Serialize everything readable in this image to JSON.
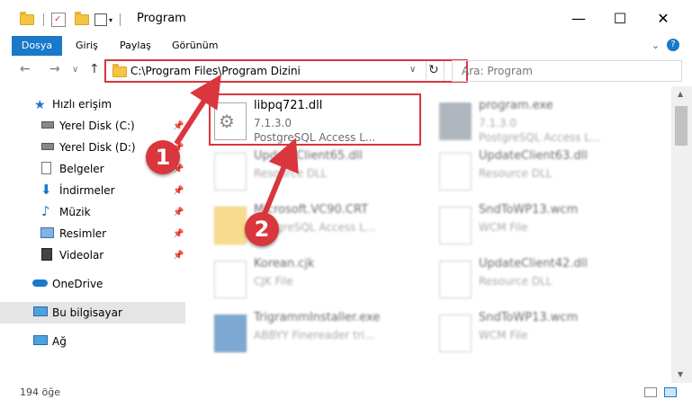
{
  "window": {
    "title": "Program",
    "minimize": "—",
    "maximize": "☐",
    "close": "✕"
  },
  "ribbon": {
    "tabs": [
      "Dosya",
      "Giriş",
      "Paylaş",
      "Görünüm"
    ],
    "expand": "⌄",
    "help": "?"
  },
  "nav": {
    "back": "←",
    "forward": "→",
    "recent": "∨",
    "up": "↑",
    "address": "C:\\Program Files\\Program Dizini",
    "address_dropdown": "∨",
    "refresh": "↻",
    "search_placeholder": "Ara: Program"
  },
  "sidebar": {
    "items": [
      {
        "label": "Hızlı erişim",
        "icon": "star-icon",
        "pinned": false
      },
      {
        "label": "Yerel Disk (C:)",
        "icon": "drive-icon",
        "pinned": true
      },
      {
        "label": "Yerel Disk (D:)",
        "icon": "drive-icon",
        "pinned": true
      },
      {
        "label": "Belgeler",
        "icon": "documents-icon",
        "pinned": true
      },
      {
        "label": "İndirmeler",
        "icon": "download-icon",
        "pinned": true
      },
      {
        "label": "Müzik",
        "icon": "music-icon",
        "pinned": true
      },
      {
        "label": "Resimler",
        "icon": "pictures-icon",
        "pinned": true
      },
      {
        "label": "Videolar",
        "icon": "videos-icon",
        "pinned": true
      },
      {
        "label": "OneDrive",
        "icon": "cloud-icon",
        "pinned": false
      },
      {
        "label": "Bu bilgisayar",
        "icon": "computer-icon",
        "pinned": false
      },
      {
        "label": "Ağ",
        "icon": "network-icon",
        "pinned": false
      }
    ]
  },
  "files": [
    {
      "name": "libpq721.dll",
      "line1": "7.1.3.0",
      "line2": "PostgreSQL Access L..."
    },
    {
      "name": "program.exe",
      "line1": "7.1.3.0",
      "line2": "PostgreSQL Access L..."
    },
    {
      "name": "UpdateClient65.dll",
      "line1": "Resource DLL",
      "line2": ""
    },
    {
      "name": "UpdateClient63.dll",
      "line1": "Resource DLL",
      "line2": ""
    },
    {
      "name": "Microsoft.VC90.CRT",
      "line1": "PostgreSQL Access L...",
      "line2": ""
    },
    {
      "name": "SndToWP13.wcm",
      "line1": "WCM File",
      "line2": ""
    },
    {
      "name": "Korean.cjk",
      "line1": "CJK File",
      "line2": ""
    },
    {
      "name": "UpdateClient42.dll",
      "line1": "Resource DLL",
      "line2": ""
    },
    {
      "name": "TrigrammInstaller.exe",
      "line1": "ABBYY Finereader tri...",
      "line2": ""
    },
    {
      "name": "SndToWP13.wcm",
      "line1": "WCM File",
      "line2": ""
    }
  ],
  "status": {
    "count": "194 öğe"
  },
  "callouts": [
    "1",
    "2"
  ],
  "colors": {
    "accent": "#1979ca",
    "highlight": "#d9363e"
  }
}
